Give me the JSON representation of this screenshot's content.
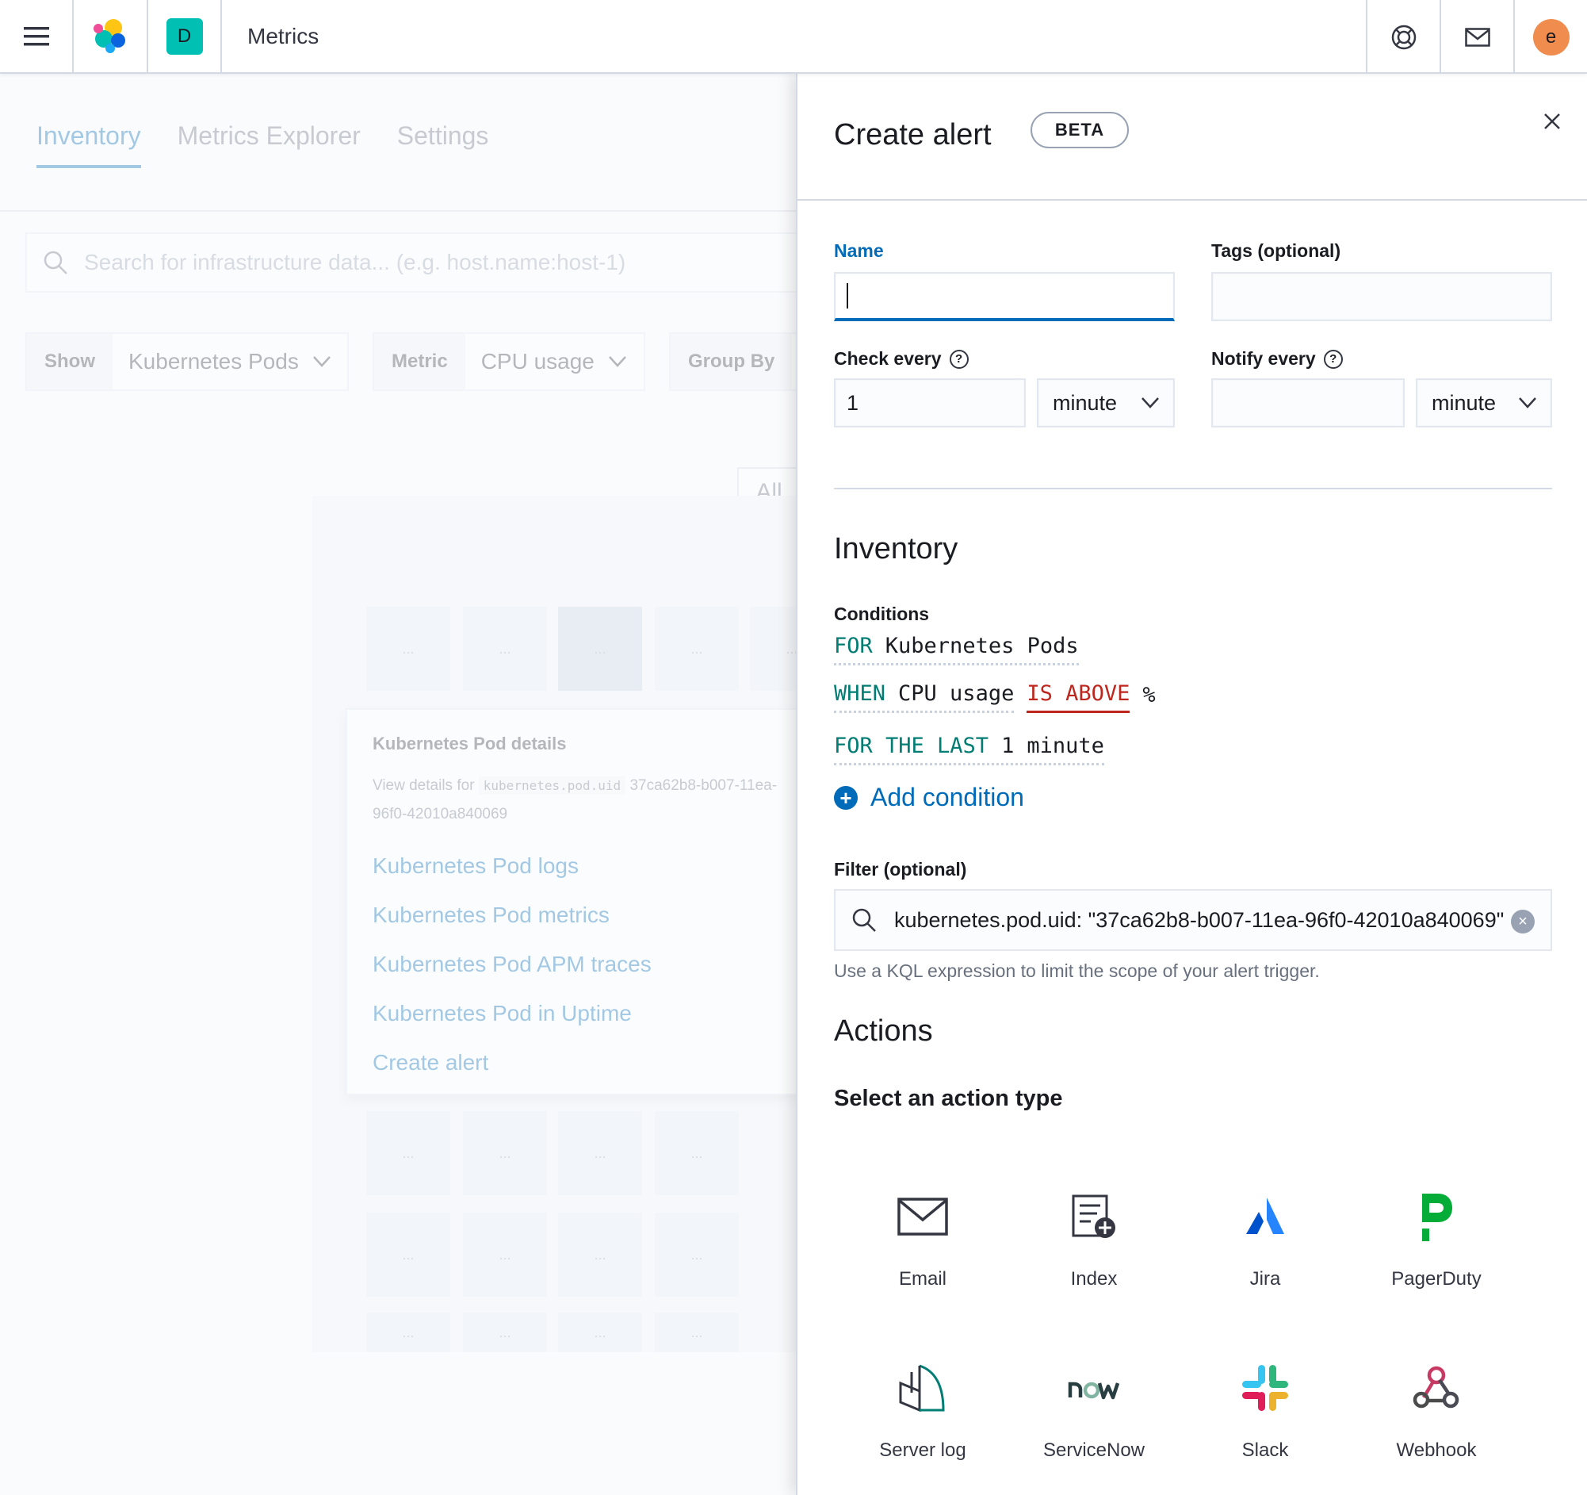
{
  "header": {
    "space_initial": "D",
    "app_title": "Metrics",
    "user_initial": "e"
  },
  "background": {
    "tabs": [
      {
        "label": "Inventory"
      },
      {
        "label": "Metrics Explorer"
      },
      {
        "label": "Settings"
      }
    ],
    "search_placeholder": "Search for infrastructure data... (e.g. host.name:host-1)",
    "filters": {
      "show_label": "Show",
      "show_value": "Kubernetes Pods",
      "metric_label": "Metric",
      "metric_value": "CPU usage",
      "group_label": "Group By"
    },
    "all_button": "All",
    "tile_label": "...",
    "popover": {
      "title": "Kubernetes Pod details",
      "desc_prefix": "View details for",
      "desc_code": "kubernetes.pod.uid",
      "desc_value": "37ca62b8-b007-11ea-96f0-42010a840069",
      "desc_line2": "a-96f0-42010a840069",
      "links": [
        "Kubernetes Pod logs",
        "Kubernetes Pod metrics",
        "Kubernetes Pod APM traces",
        "Kubernetes Pod in Uptime",
        "Create alert"
      ]
    }
  },
  "flyout": {
    "title": "Create alert",
    "badge": "BETA",
    "name_label": "Name",
    "name_value": "",
    "tags_label": "Tags (optional)",
    "tags_value": "",
    "check_every_label": "Check every",
    "check_every_value": "1",
    "check_every_unit": "minute",
    "notify_every_label": "Notify every",
    "notify_every_value": "",
    "notify_every_unit": "minute",
    "section_title": "Inventory",
    "conditions_label": "Conditions",
    "conditions": {
      "for_kw": "FOR",
      "for_val": "Kubernetes Pods",
      "when_kw": "WHEN",
      "when_val": "CPU usage",
      "is_above": "IS ABOVE",
      "unit": "%",
      "last_kw": "FOR THE LAST",
      "last_num": "1",
      "last_unit": "minute"
    },
    "add_condition": "Add condition",
    "filter_label": "Filter (optional)",
    "filter_value": "kubernetes.pod.uid: \"37ca62b8-b007-11ea-96f0-42010a840069\"",
    "filter_help": "Use a KQL expression to limit the scope of your alert trigger.",
    "actions_title": "Actions",
    "select_action_title": "Select an action type",
    "actions": [
      {
        "name": "Email",
        "icon": "email-icon"
      },
      {
        "name": "Index",
        "icon": "index-icon"
      },
      {
        "name": "Jira",
        "icon": "jira-icon"
      },
      {
        "name": "PagerDuty",
        "icon": "pagerduty-icon"
      },
      {
        "name": "Server log",
        "icon": "server-log-icon"
      },
      {
        "name": "ServiceNow",
        "icon": "servicenow-icon"
      },
      {
        "name": "Slack",
        "icon": "slack-icon"
      },
      {
        "name": "Webhook",
        "icon": "webhook-icon"
      }
    ]
  },
  "colors": {
    "accent": "#006bb8",
    "keyword": "#017d73",
    "danger": "#bd271e",
    "space_badge": "#00bfb3",
    "avatar": "#f08c4e"
  }
}
